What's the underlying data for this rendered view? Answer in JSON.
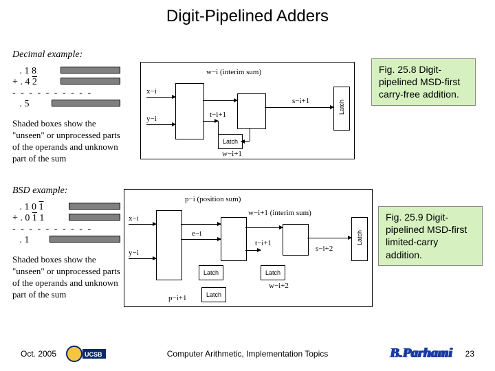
{
  "title": "Digit-Pipelined Adders",
  "decimal": {
    "label": "Decimal example:",
    "row1": ". 1 8",
    "row2": "+ . 4 2",
    "row2_neg_index": 2,
    "dash": "- - - - - - - - - -",
    "row3": ". 5",
    "desc": "Shaded boxes show the \"unseen\" or unprocessed parts of the operands and unknown part of the sum"
  },
  "bsd": {
    "label": "BSD example:",
    "row1": ". 1 0 1",
    "row1_neg_index": 3,
    "row2": "+ . 0 1 1",
    "row2_neg_index": 2,
    "dash": "- - - - - - - - - -",
    "row3": ". 1",
    "desc": "Shaded boxes show the \"unseen\" or unprocessed parts of the operands and unknown part of the sum"
  },
  "caption1": "Fig. 25.8 Digit-pipelined MSD-first carry-free addition.",
  "caption2": "Fig. 25.9 Digit-pipelined MSD-first limited-carry addition.",
  "diagram1": {
    "x_in": "x−i",
    "y_in": "y−i",
    "w_top": "w−i  (interim sum)",
    "t_label": "t−i+1",
    "latch": "Latch",
    "w_bot": "w−i+1",
    "s_out": "s−i+1",
    "latch_out": "Latch"
  },
  "diagram2": {
    "x_in": "x−i",
    "y_in": "y−i",
    "p_top": "p−i  (position sum)",
    "e_label": "e−i",
    "w_label": "w−i+1  (interim sum)",
    "t_label": "t−i+1",
    "latch": "Latch",
    "w_bot": "w−i+2",
    "s_out": "s−i+2",
    "latch_out": "Latch",
    "p_bot": "p−i+1"
  },
  "footer": {
    "date": "Oct. 2005",
    "center": "Computer Arithmetic, Implementation Topics",
    "page": "23",
    "author": "B.Parhami",
    "logo_text": "UCSB"
  }
}
